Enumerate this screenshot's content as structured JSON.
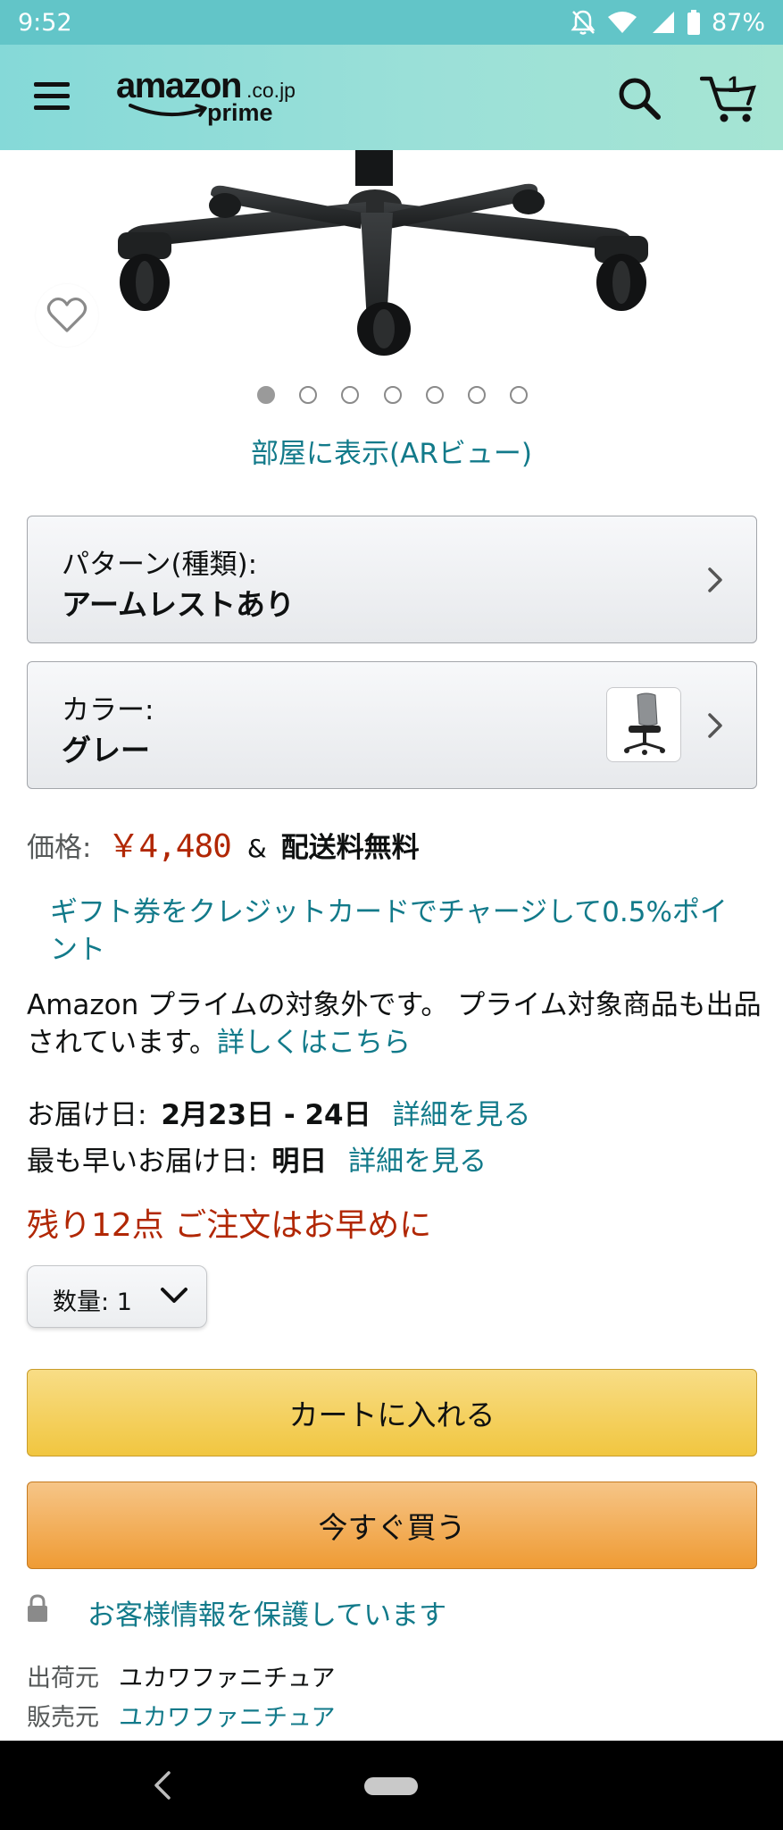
{
  "status_bar": {
    "time": "9:52",
    "battery": "87%",
    "icons": [
      "bell-off-icon",
      "wifi-icon",
      "signal-icon",
      "battery-icon"
    ]
  },
  "header": {
    "logo_amazon": "amazon",
    "logo_domain": ".co.jp",
    "logo_prime": "prime",
    "cart_count": "1",
    "icons": [
      "menu-icon",
      "search-icon",
      "cart-icon"
    ]
  },
  "gallery": {
    "image_count": 7,
    "active_index": 0
  },
  "ar_view": {
    "label": "部屋に表示(ARビュー)"
  },
  "pattern_selector": {
    "label": "パターン(種類):",
    "value": "アームレストあり"
  },
  "color_selector": {
    "label": "カラー:",
    "value": "グレー"
  },
  "price": {
    "label": "価格:",
    "value": "￥4,480",
    "amp": "&",
    "shipping": "配送料無料"
  },
  "gift_link": "ギフト券をクレジットカードでチャージして0.5%ポイント",
  "prime_note": {
    "text": "Amazon プライムの対象外です。 プライム対象商品も出品されています。",
    "link": "詳しくはこちら"
  },
  "delivery": {
    "label": "お届け日:",
    "dates": "2月23日 - 24日",
    "link": "詳細を見る"
  },
  "fastest_delivery": {
    "label": "最も早いお届け日:",
    "date": "明日",
    "link": "詳細を見る"
  },
  "stock_warning": "残り12点 ご注文はお早めに",
  "quantity": {
    "label": "数量:",
    "value": "1"
  },
  "buttons": {
    "add_to_cart": "カートに入れる",
    "buy_now": "今すぐ買う"
  },
  "secure_text": "お客様情報を保護しています",
  "seller_info": {
    "ships_from_label": "出荷元",
    "ships_from_value": "ユカワファニチュア",
    "sold_by_label": "販売元",
    "sold_by_value": "ユカワファニチュア"
  },
  "colors": {
    "status_bar": "#62c5c8",
    "header": "#a6e5d3",
    "link": "#127a8a",
    "price": "#b12704",
    "cart_button": "#f1c640",
    "buy_button": "#ef9b34"
  }
}
